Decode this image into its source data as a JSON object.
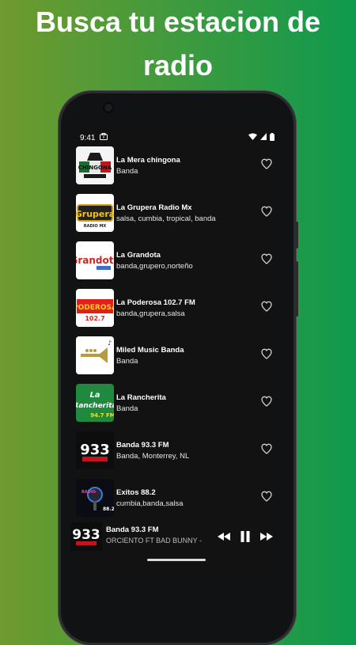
{
  "headline": "Busca tu estacion de radio",
  "status": {
    "time": "9:41"
  },
  "stations": [
    {
      "name": "La Mera chingona",
      "genre": "Banda",
      "logo_text": "CHINGONA",
      "logo_style": "chingona",
      "icon": "la-mera-chingona-logo"
    },
    {
      "name": "La Grupera Radio Mx",
      "genre": "salsa, cumbia, tropical, banda",
      "logo_text": "Grupera",
      "logo_style": "grupera",
      "icon": "la-grupera-logo"
    },
    {
      "name": "La Grandota",
      "genre": "banda,grupero,norteño",
      "logo_text": "Grandota",
      "logo_style": "grandota",
      "icon": "la-grandota-logo"
    },
    {
      "name": " La Poderosa 102.7 FM",
      "genre": "banda,grupera,salsa",
      "logo_text": "PODEROSA",
      "logo_style": "poderosa",
      "icon": "la-poderosa-logo"
    },
    {
      "name": "Miled Music Banda",
      "genre": "Banda",
      "logo_text": "♪",
      "logo_style": "miled",
      "icon": "trumpet-logo"
    },
    {
      "name": "La Rancherita",
      "genre": "Banda",
      "logo_text": "Rancherita",
      "logo_style": "rancherita",
      "icon": "la-rancherita-logo"
    },
    {
      "name": "Banda 93.3 FM",
      "genre": "Banda, Monterrey, NL",
      "logo_text": "933",
      "logo_style": "banda933",
      "icon": "banda-933-logo"
    },
    {
      "name": "Exitos 88.2",
      "genre": "cumbia,banda,salsa",
      "logo_text": "88.2",
      "logo_style": "exitos",
      "icon": "exitos-882-logo"
    }
  ],
  "player": {
    "station": "Banda 93.3 FM",
    "track": "ORCIENTO FT BAD BUNNY  - FR",
    "logo_text": "933"
  },
  "colors": {
    "accent_green": "#0e9a4e",
    "screen_bg": "#121212"
  }
}
